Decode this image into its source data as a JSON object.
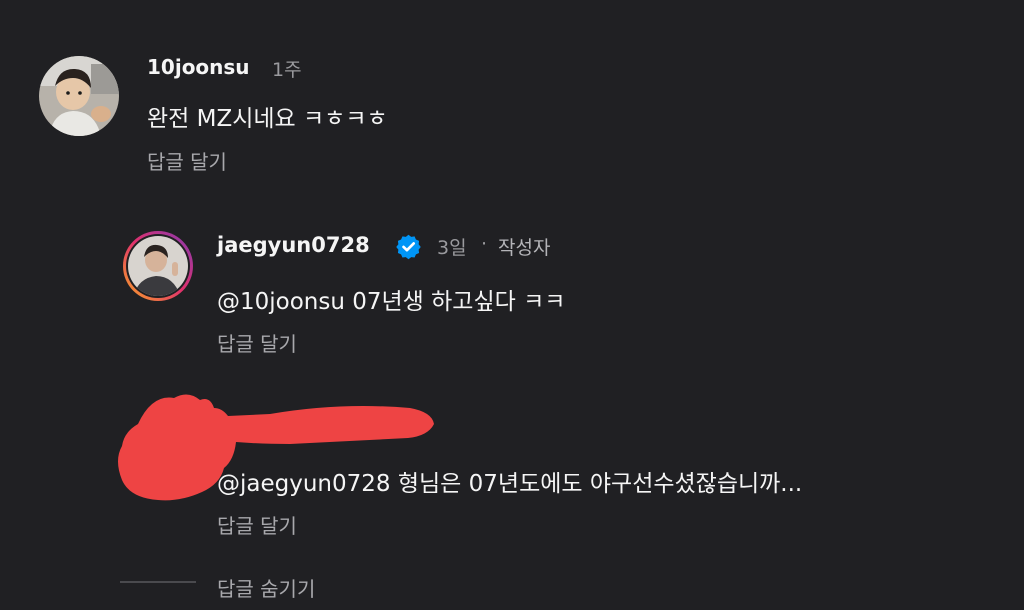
{
  "comments": [
    {
      "username": "10joonsu",
      "time": "1주",
      "text": "완전 MZ시네요 ㅋㅎㅋㅎ",
      "reply_label": "답글 달기",
      "avatar_icon": "child-photo-avatar"
    },
    {
      "username": "jaegyun0728",
      "verified": true,
      "verified_icon": "verified-badge-icon",
      "time": "3일",
      "separator": "·",
      "author_badge": "작성자",
      "mention": "@10joonsu",
      "text": "07년생 하고싶다 ㅋㅋ",
      "reply_label": "답글 달기",
      "avatar_icon": "profile-photo-avatar-gradient-ring"
    },
    {
      "username_redacted": true,
      "mention": "@jaegyun0728",
      "text": "형님은 07년도에도 야구선수셨잖습니까...",
      "reply_label": "답글 달기"
    }
  ],
  "hide_replies_label": "답글 숨기기",
  "colors": {
    "background": "#202023",
    "text_primary": "#f5f5f5",
    "text_secondary": "#9a9a9e",
    "verified_blue": "#0095f6",
    "redaction_red": "#ee4444"
  }
}
